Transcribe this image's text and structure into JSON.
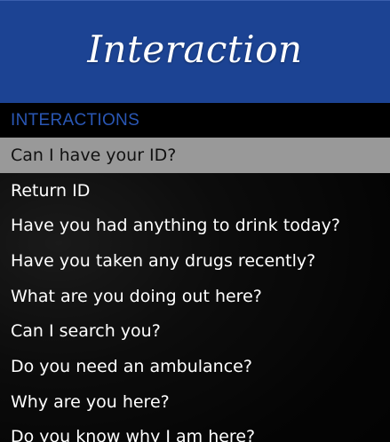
{
  "banner": {
    "title": "Interaction",
    "color": "#1c4393"
  },
  "subtitle": "INTERACTIONS",
  "menu": {
    "selected_index": 0,
    "items": [
      "Can I have your ID?",
      "Return ID",
      "Have you had anything to drink today?",
      "Have you taken any drugs recently?",
      "What are you doing out here?",
      "Can I search you?",
      "Do you need an ambulance?",
      "Why are you here?",
      "Do you know why I am here?"
    ]
  }
}
